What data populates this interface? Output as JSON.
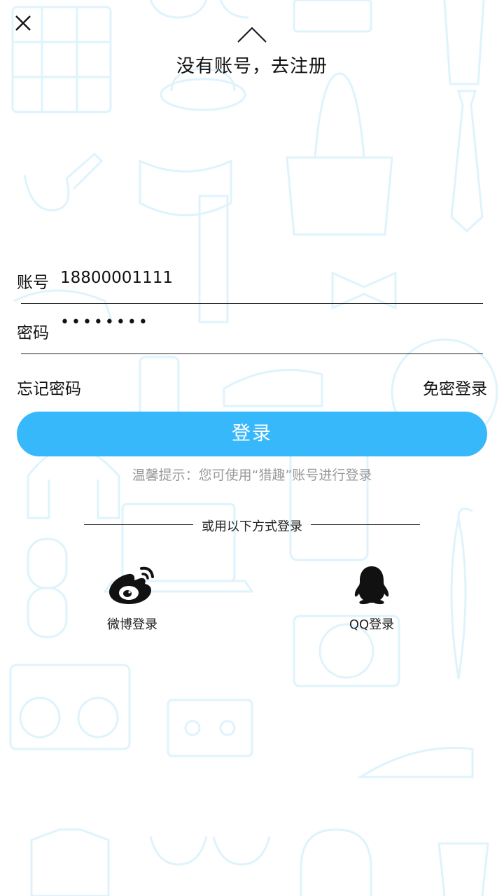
{
  "header": {
    "register_prompt": "没有账号，去注册"
  },
  "form": {
    "account_label": "账号",
    "account_value": "18800001111",
    "password_label": "密码",
    "password_mask": "••••••••"
  },
  "links": {
    "forgot_password": "忘记密码",
    "password_free_login": "免密登录"
  },
  "login_button": "登录",
  "tip": "温馨提示：您可使用“猎趣”账号进行登录",
  "alt_login": {
    "divider_text": "或用以下方式登录",
    "weibo_label": "微博登录",
    "qq_label": "QQ登录"
  },
  "colors": {
    "accent": "#37b8fb",
    "background_pattern": "#dff3fc"
  },
  "icons": {
    "close": "close-icon",
    "up": "chevron-up-icon",
    "weibo": "weibo-icon",
    "qq": "qq-icon"
  }
}
